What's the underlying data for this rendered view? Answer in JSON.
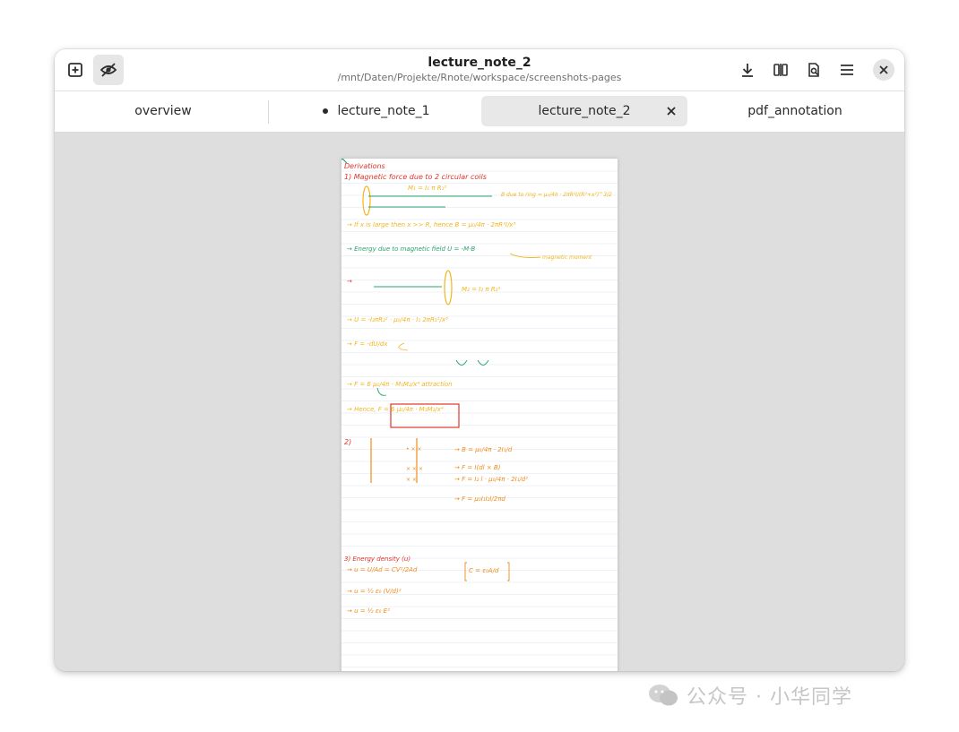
{
  "window": {
    "title": "lecture_note_2",
    "subtitle": "/mnt/Daten/Projekte/Rnote/workspace/screenshots-pages"
  },
  "headerbar": {
    "left_icons": [
      "add-page-icon",
      "hidden-eye-icon"
    ],
    "right_icons": [
      "download-icon",
      "pages-icon",
      "document-search-icon",
      "menu-icon",
      "close-icon"
    ]
  },
  "tabs": [
    {
      "label": "overview",
      "modified": false,
      "selected": false
    },
    {
      "label": "lecture_note_1",
      "modified": true,
      "selected": false
    },
    {
      "label": "lecture_note_2",
      "modified": false,
      "selected": true
    },
    {
      "label": "pdf_annotation",
      "modified": false,
      "selected": false
    }
  ],
  "document": {
    "heading": "Derivations",
    "notes": [
      {
        "text": "1) Magnetic force due to 2 circular coils",
        "color": "#e0352b"
      },
      {
        "text": "M₁ = I₁ π R₁²",
        "color": "#f2b51a"
      },
      {
        "text": "B due to ring = μ₀/4π · 2πR²I/(R²+x²)^3/2",
        "color": "#f2b51a"
      },
      {
        "text": "→ If x is large then x >> R, hence B = μ₀/4π · 2πR²I/x³",
        "color": "#f2b51a"
      },
      {
        "text": "→ Energy due to magnetic field U = -M·B",
        "color": "#2aa36b"
      },
      {
        "text": "magnetic moment",
        "color": "#f2b51a"
      },
      {
        "text": "M₂ = I₂ π R₂²",
        "color": "#f2b51a"
      },
      {
        "text": "→ U = -I₂πR₂² · μ₀/4π · I₁ 2πR₁²/x³",
        "color": "#f2b51a"
      },
      {
        "text": "→ F = -dU/dx",
        "color": "#f2b51a"
      },
      {
        "text": "→ F = 6 μ₀/4π · M₁M₂/x⁴  attraction",
        "color": "#f2b51a"
      },
      {
        "text": "→ Hence, F = 6 μ₀/4π · M₁M₂/x⁴",
        "color": "#e0352b"
      },
      {
        "text": "2)",
        "color": "#e0352b"
      },
      {
        "text": "→ B = μ₀/4π · 2I₁/d",
        "color": "#f28a1a"
      },
      {
        "text": "→ F = I(dl × B)",
        "color": "#f28a1a"
      },
      {
        "text": "→ F = I₂ l · μ₀/4π · 2I₁/d²",
        "color": "#f28a1a"
      },
      {
        "text": "→ F = μ₀I₁I₂l/2πd",
        "color": "#f28a1a"
      },
      {
        "text": "3) Energy density (u)",
        "color": "#e0352b"
      },
      {
        "text": "→ u = U/Ad = CV²/2Ad",
        "color": "#f28a1a"
      },
      {
        "text": "C = ε₀A/d",
        "color": "#f28a1a"
      },
      {
        "text": "→ u = ½ ε₀ (V/d)²",
        "color": "#f28a1a"
      },
      {
        "text": "→ u = ½ ε₀ E²",
        "color": "#f28a1a"
      }
    ]
  },
  "watermark": {
    "text": "公众号 · 小华同学"
  },
  "colors": {
    "red": "#e0352b",
    "yellow": "#f2b51a",
    "green": "#2aa36b",
    "orange": "#f28a1a",
    "ruled_line": "#e9eef5"
  }
}
